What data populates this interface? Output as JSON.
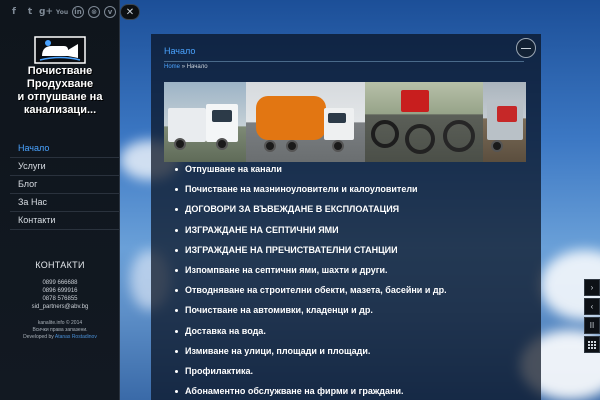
{
  "social": {
    "icons": [
      "facebook-icon",
      "twitter-icon",
      "google-plus-icon",
      "youtube-icon",
      "flickr-icon",
      "dribbble-icon",
      "vimeo-icon"
    ],
    "glyphs": [
      "f",
      "t",
      "g+",
      "You",
      "in",
      "⊗",
      "v"
    ]
  },
  "brand": {
    "line1": "Почистване",
    "line2": "Продухване",
    "line3": "и отпушване на",
    "line4": "канализаци..."
  },
  "nav": {
    "items": [
      {
        "label": "Начало",
        "active": true
      },
      {
        "label": "Услуги",
        "active": false
      },
      {
        "label": "Блог",
        "active": false
      },
      {
        "label": "За Нас",
        "active": false
      },
      {
        "label": "Контакти",
        "active": false
      }
    ]
  },
  "contacts": {
    "title": "КОНТАКТИ",
    "phone1": "0899 666688",
    "phone2": "0896 699916",
    "phone3": "0878 576855",
    "email": "sid_partners@abv.bg"
  },
  "footer": {
    "line1": "kanalite.info © 2014",
    "line2": "Всички права запазени.",
    "developed_by": "Developed by",
    "developer": "Atanas Rostadinov"
  },
  "close_glyph": "✕",
  "main": {
    "title": "Начало",
    "breadcrumb_home": "Home",
    "breadcrumb_sep": "»",
    "breadcrumb_current": "Начало",
    "services": [
      "Отпушване на канали",
      "Почистване на мазниноуловители и калоуловители",
      "ДОГОВОРИ ЗА ВЪВЕЖДАНЕ В ЕКСПЛОАТАЦИЯ",
      "ИЗГРАЖДАНЕ НА СЕПТИЧНИ ЯМИ",
      "ИЗГРАЖДАНЕ НА ПРЕЧИСТВАТЕЛНИ СТАНЦИИ",
      "Изпомпване на септични ями, шахти и други.",
      "Отводняване на строителни обекти, мазета, басейни и др.",
      "Почистване на автомивки, кладенци и др.",
      "Доставка на вода.",
      "Измиване на улици, площади и площади.",
      "Профилактика.",
      "Абонаментно обслужване на фирми и граждани."
    ]
  },
  "slider_controls": {
    "next_glyph": "›",
    "prev_glyph": "‹",
    "pause_glyph": "II"
  }
}
